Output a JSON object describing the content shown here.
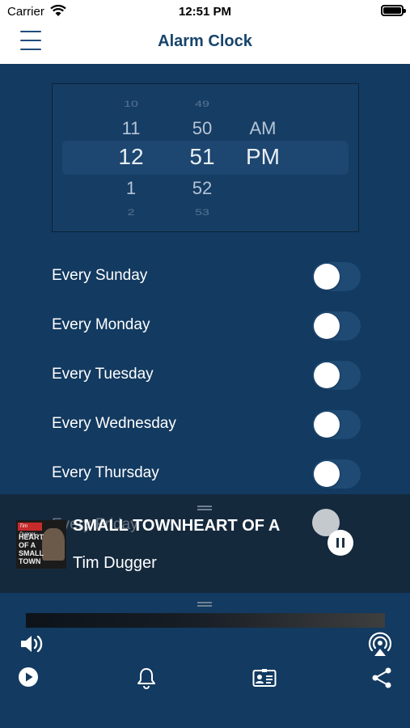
{
  "status_bar": {
    "carrier": "Carrier",
    "time": "12:51 PM"
  },
  "header": {
    "title": "Alarm Clock"
  },
  "picker": {
    "hours": [
      "10",
      "11",
      "12",
      "1",
      "2"
    ],
    "minutes": [
      "49",
      "50",
      "51",
      "52",
      "53"
    ],
    "periods": [
      "",
      "AM",
      "PM",
      "",
      ""
    ],
    "selected": {
      "hour": "12",
      "minute": "51",
      "period": "PM"
    }
  },
  "days": [
    {
      "label": "Every Sunday",
      "enabled": false
    },
    {
      "label": "Every Monday",
      "enabled": false
    },
    {
      "label": "Every Tuesday",
      "enabled": false
    },
    {
      "label": "Every Wednesday",
      "enabled": false
    },
    {
      "label": "Every Thursday",
      "enabled": false
    },
    {
      "label": "Every Friday",
      "enabled": false
    }
  ],
  "now_playing": {
    "title": "SMALL TOWNHEART OF A",
    "artist": "Tim Dugger",
    "art_brand": "Tim Dugger",
    "art_text": "HEART OF A SMALL TOWN"
  },
  "icons": {
    "menu": "hamburger-menu-icon",
    "volume": "speaker-icon",
    "airplay": "airplay-icon",
    "play": "play-icon",
    "alarm": "bell-icon",
    "contact": "contact-card-icon",
    "share": "share-icon",
    "pause": "pause-icon"
  },
  "colors": {
    "background": "#133a60",
    "header_text": "#17446b",
    "toggle_off": "#1e4a74"
  }
}
